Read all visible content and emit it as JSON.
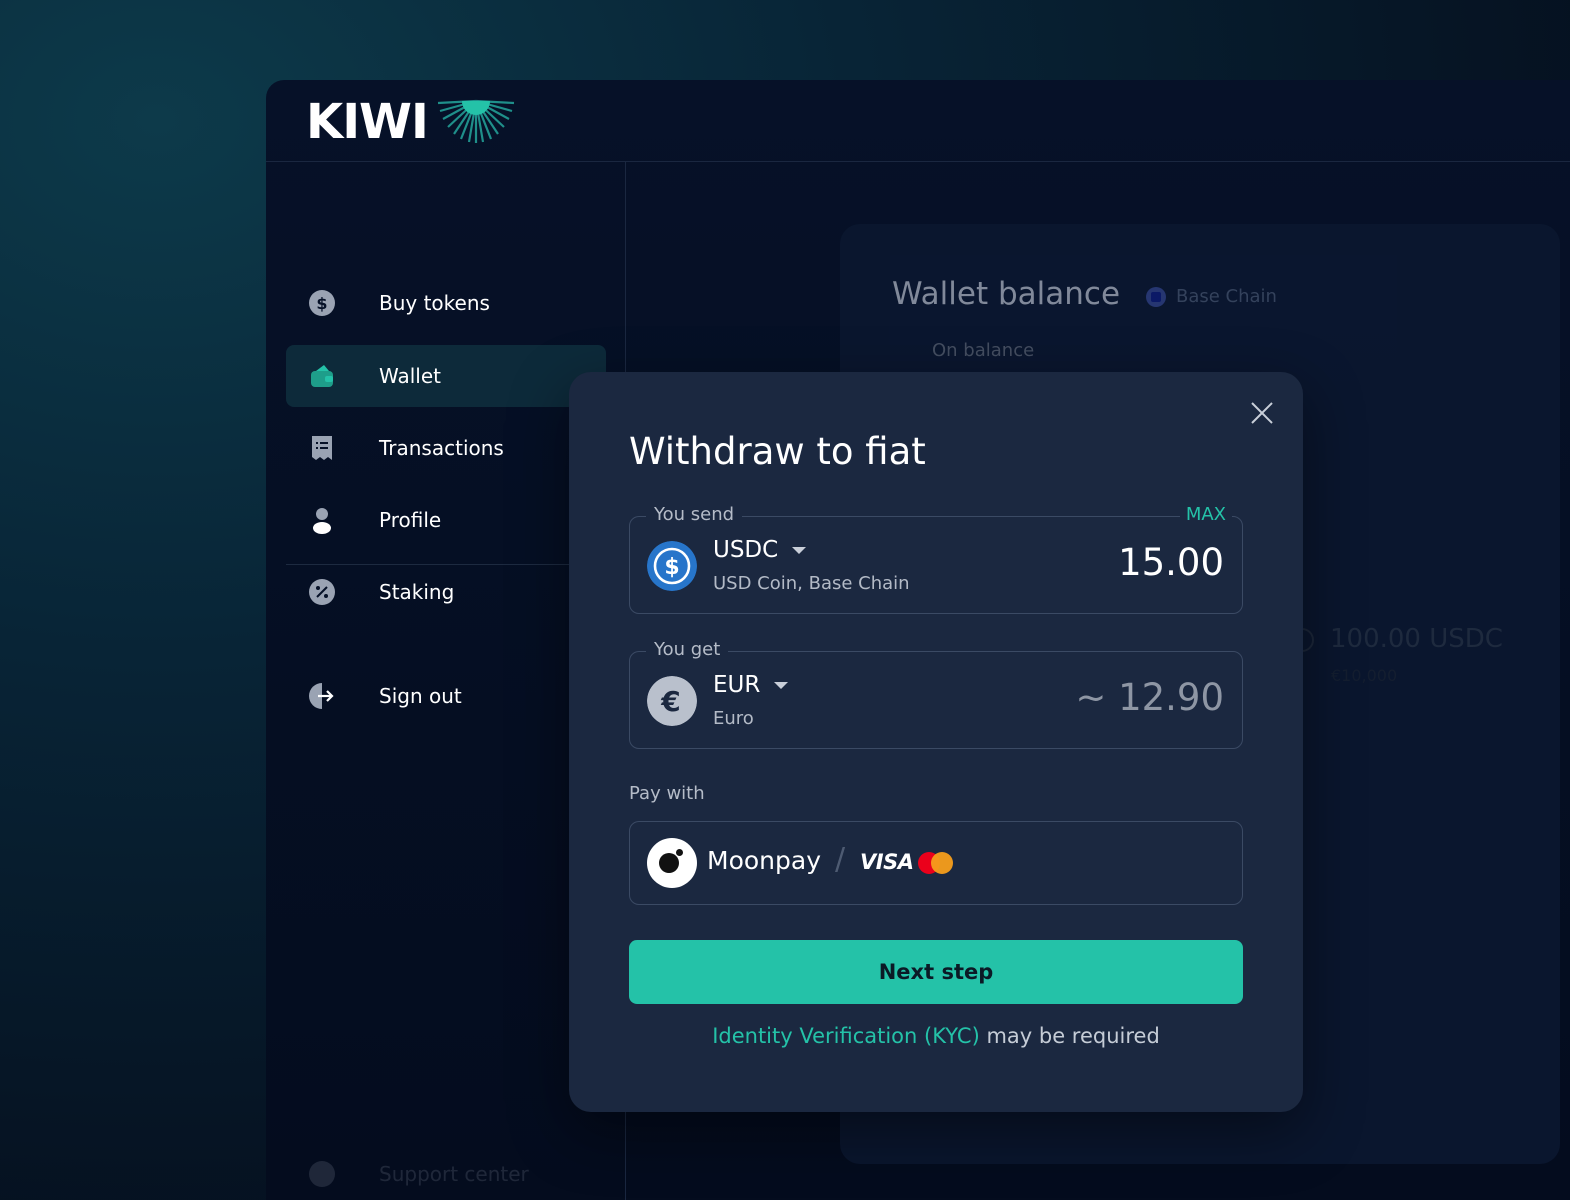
{
  "app": {
    "logo_text": "KIWI",
    "colors": {
      "accent": "#24c2a8",
      "modal_bg": "#1b2840",
      "page_bg": "#061128"
    }
  },
  "sidebar": {
    "items": [
      {
        "label": "Buy tokens",
        "icon": "dollar-coin-icon",
        "active": false
      },
      {
        "label": "Wallet",
        "icon": "wallet-icon",
        "active": true
      },
      {
        "label": "Transactions",
        "icon": "receipt-icon",
        "active": false
      },
      {
        "label": "Profile",
        "icon": "user-icon",
        "active": false
      },
      {
        "label": "Staking",
        "icon": "percent-icon",
        "active": false
      }
    ],
    "sign_out": "Sign out",
    "support": "Support center"
  },
  "wallet_card": {
    "title": "Wallet balance",
    "chain": "Base Chain",
    "on_balance": "On balance",
    "amount": "100.00 USDC",
    "fiat": "€10,000"
  },
  "modal": {
    "title": "Withdraw to fiat",
    "send": {
      "legend": "You send",
      "max_label": "MAX",
      "code": "USDC",
      "name": "USD Coin, Base Chain",
      "amount": "15.00"
    },
    "get": {
      "legend": "You get",
      "code": "EUR",
      "name": "Euro",
      "amount": "~ 12.90"
    },
    "pay_with": {
      "label": "Pay with",
      "provider": "Moonpay",
      "separator": "/",
      "card_brand": "VISA"
    },
    "next_button": "Next step",
    "kyc_link": "Identity Verification (KYC)",
    "kyc_suffix": " may be required"
  }
}
